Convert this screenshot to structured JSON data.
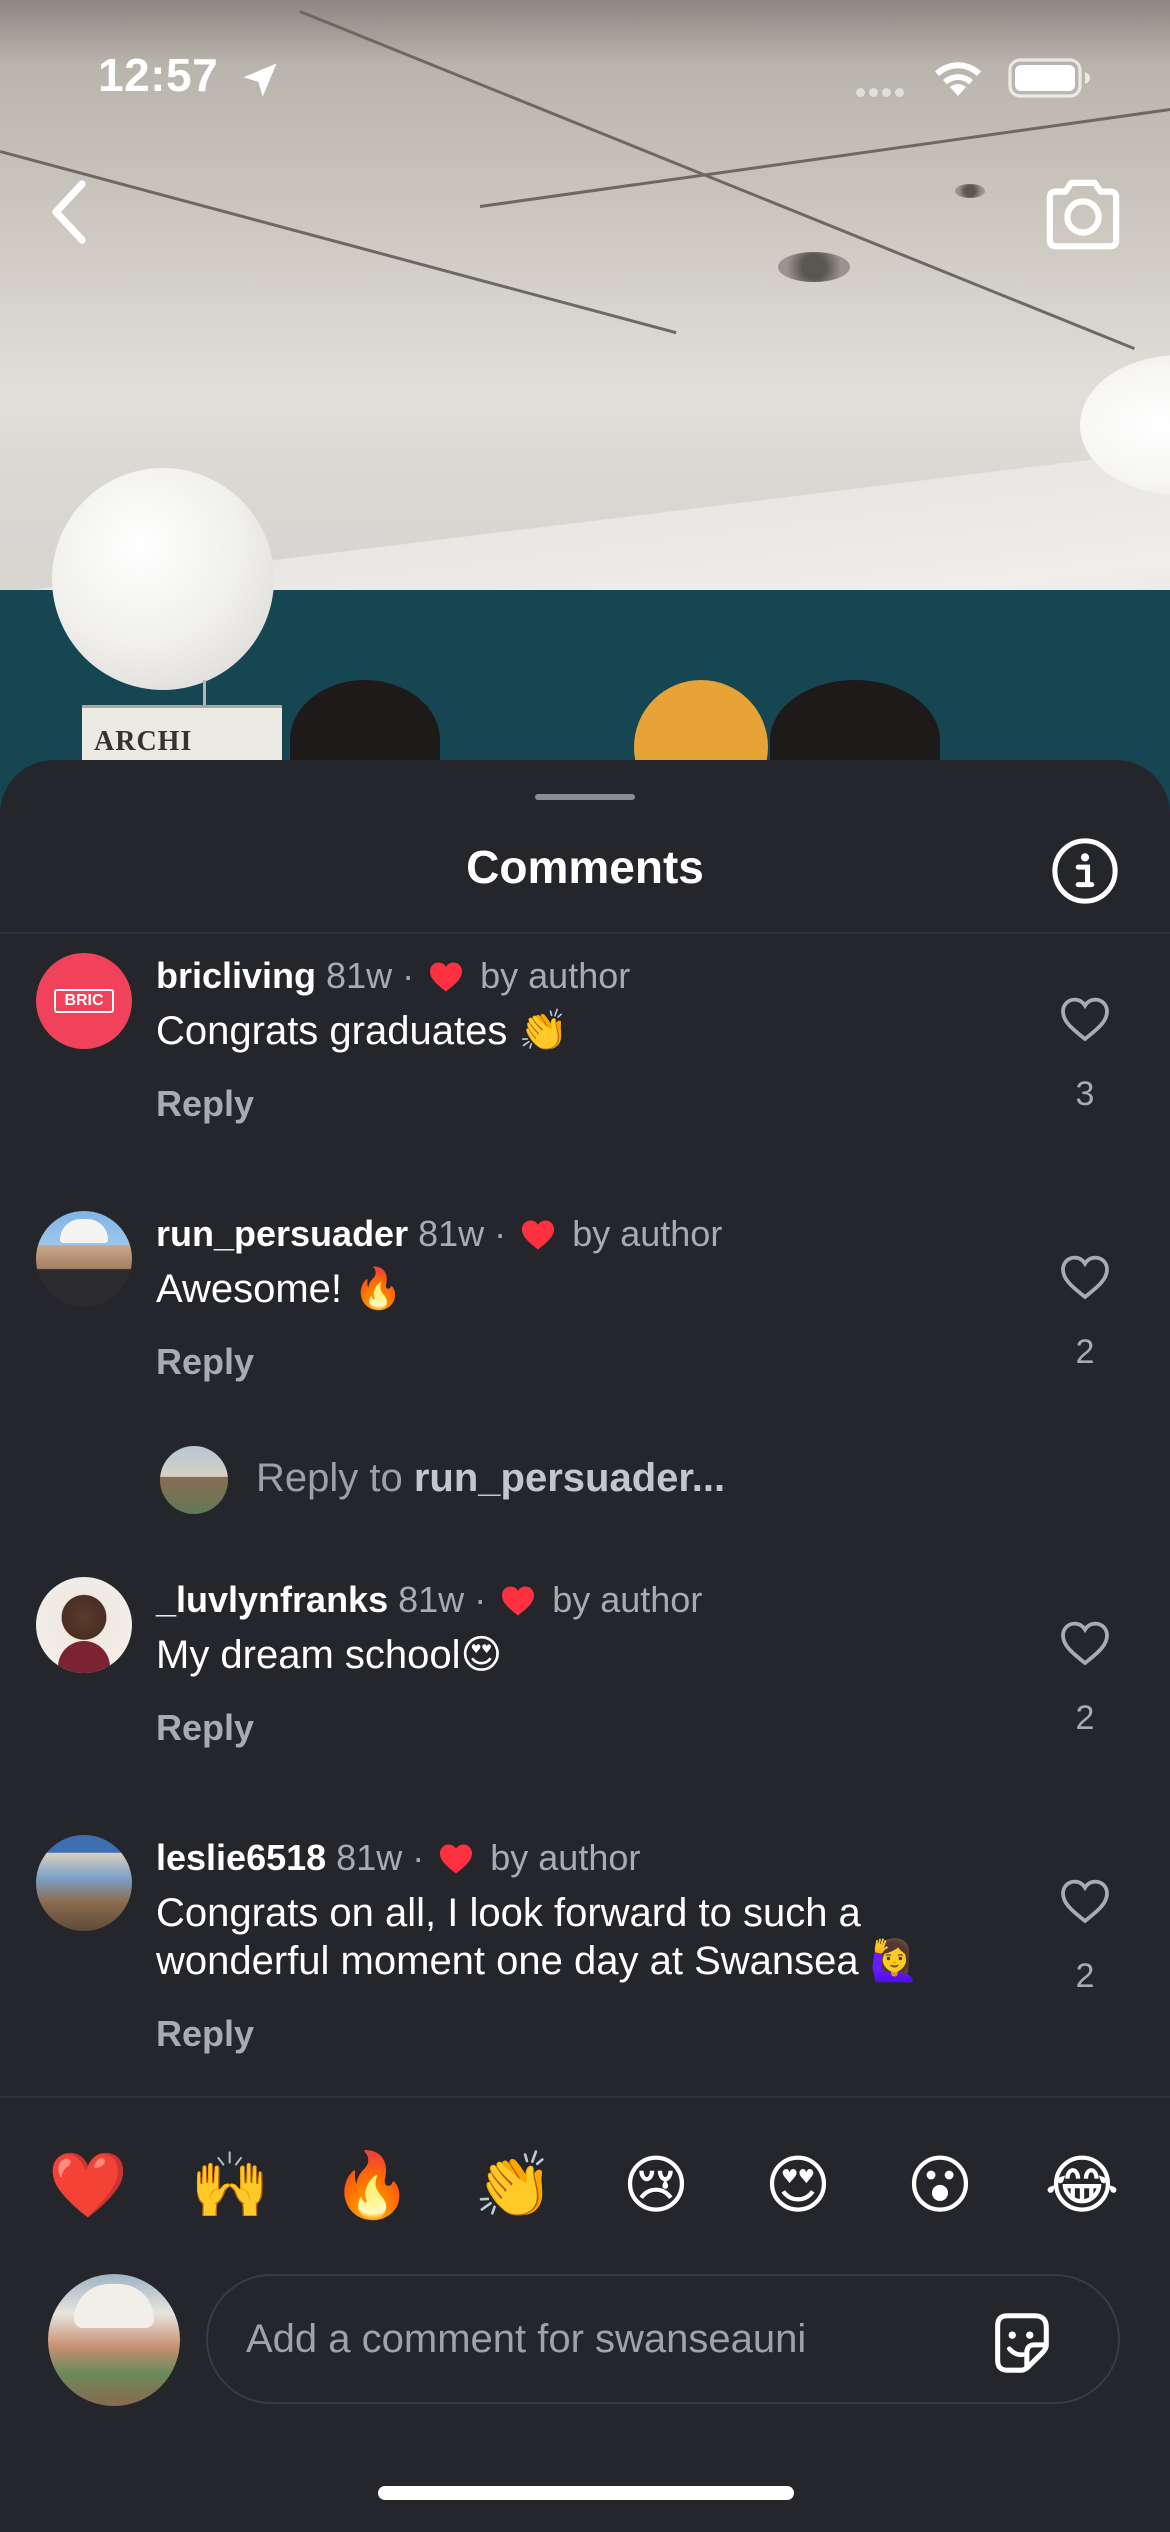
{
  "status_bar": {
    "time": "12:57",
    "location_icon": "location-arrow-icon",
    "wifi_icon": "wifi-icon",
    "battery_icon": "battery-icon"
  },
  "background": {
    "sign_text": "ARCHI BYCH"
  },
  "nav": {
    "back_icon": "chevron-left-icon",
    "camera_icon": "camera-icon"
  },
  "sheet": {
    "title": "Comments",
    "info_icon": "info-icon"
  },
  "comments": [
    {
      "username": "bricliving",
      "age": "81w",
      "separator": "·",
      "liked_by": "by author",
      "text": "Congrats graduates 👏",
      "reply_label": "Reply",
      "likes": "3",
      "avatar_badge": "BRIC",
      "avatar_color": "#f0425a"
    },
    {
      "username": "run_persuader",
      "age": "81w",
      "separator": "·",
      "liked_by": "by author",
      "text": "Awesome! 🔥",
      "reply_label": "Reply",
      "likes": "2"
    },
    {
      "username": "_luvlynfranks",
      "age": "81w",
      "separator": "·",
      "liked_by": "by author",
      "text": "My dream school😍",
      "reply_label": "Reply",
      "likes": "2"
    },
    {
      "username": "leslie6518",
      "age": "81w",
      "separator": "·",
      "liked_by": "by author",
      "text": "Congrats on all,  I look forward to such a wonderful moment one day at Swansea 🙋‍♀️",
      "reply_label": "Reply",
      "likes": "2"
    }
  ],
  "reply_prompt": {
    "prefix": "Reply to ",
    "username": "run_persuader..."
  },
  "quick_emojis": [
    "❤️",
    "🙌",
    "🔥",
    "👏",
    "😢",
    "😍",
    "😮",
    "😂"
  ],
  "composer": {
    "placeholder": "Add a comment for swanseauni",
    "sticker_icon": "sticker-icon"
  },
  "colors": {
    "sheet_bg": "#24262b",
    "heart_red": "#ff3040",
    "muted_text": "#a8abb2"
  }
}
